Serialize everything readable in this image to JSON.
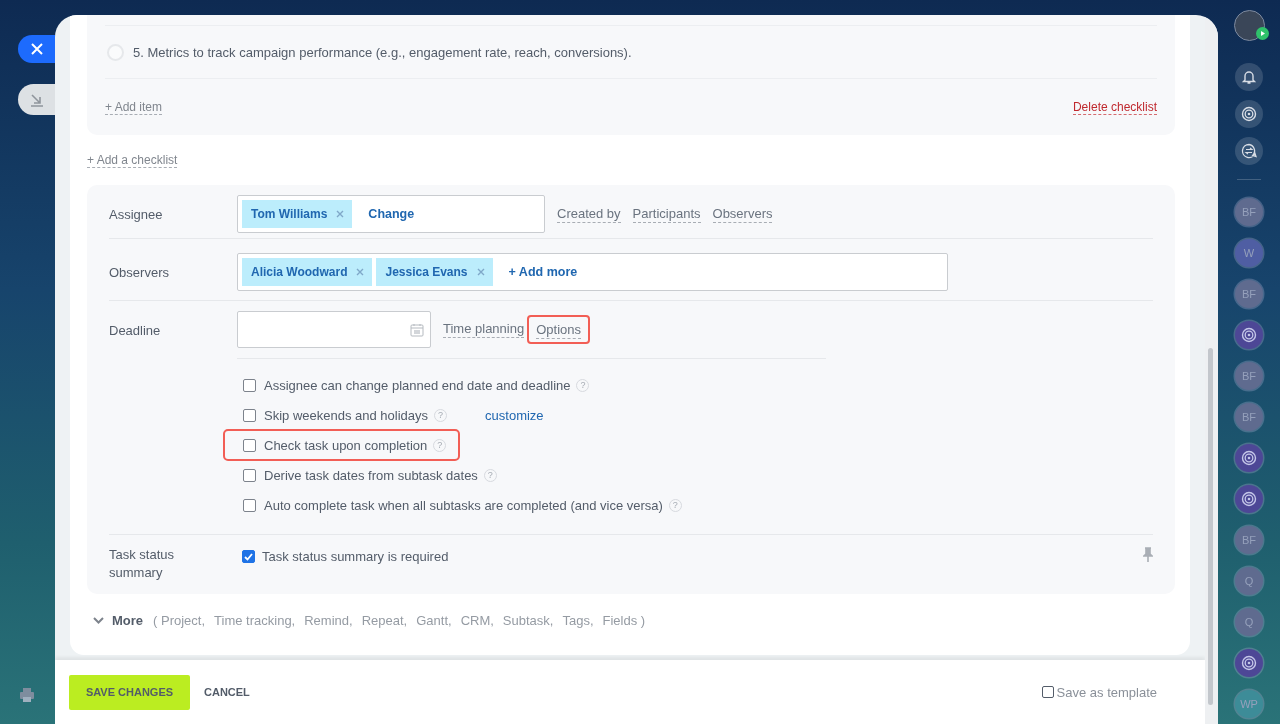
{
  "checklist": {
    "items": [
      {
        "text": "5. Metrics to track campaign performance (e.g., engagement rate, reach, conversions).",
        "checked": false
      }
    ],
    "add_item": "+ Add item",
    "delete": "Delete checklist"
  },
  "add_checklist": "+ Add a checklist",
  "assignee": {
    "label": "Assignee",
    "chips": [
      "Tom Williams"
    ],
    "action": "Change",
    "links": [
      "Created by",
      "Participants",
      "Observers"
    ]
  },
  "observers": {
    "label": "Observers",
    "chips": [
      "Alicia Woodward",
      "Jessica Evans"
    ],
    "action": "+ Add more"
  },
  "deadline": {
    "label": "Deadline",
    "links": [
      {
        "text": "Time planning",
        "highlighted": false
      },
      {
        "text": "Options",
        "highlighted": true
      }
    ]
  },
  "options": [
    {
      "label": "Assignee can change planned end date and deadline",
      "checked": false,
      "help": "?",
      "highlighted": false
    },
    {
      "label": "Skip weekends and holidays",
      "checked": false,
      "help": "?",
      "link": "customize",
      "highlighted": false
    },
    {
      "label": "Check task upon completion",
      "checked": false,
      "help": "?",
      "highlighted": true
    },
    {
      "label": "Derive task dates from subtask dates",
      "checked": false,
      "help": "?",
      "highlighted": false
    },
    {
      "label": "Auto complete task when all subtasks are completed (and vice versa)",
      "checked": false,
      "help": "?",
      "highlighted": false
    }
  ],
  "status_summary": {
    "label": "Task status summary",
    "option": {
      "label": "Task status summary is required",
      "checked": true
    }
  },
  "more": {
    "label": "More",
    "expanded": false,
    "items": [
      "( Project,",
      "Time tracking,",
      "Remind,",
      "Repeat,",
      "Gantt,",
      "CRM,",
      "Subtask,",
      "Tags,",
      "Fields )"
    ]
  },
  "footer": {
    "save": "SAVE CHANGES",
    "cancel": "CANCEL",
    "template": {
      "label": "Save as template",
      "checked": false
    }
  },
  "sidebar": {
    "chats": [
      {
        "kind": "initials",
        "text": "BF",
        "color": "#5f6b8f"
      },
      {
        "kind": "initials",
        "text": "W",
        "color": "#4f5ea3"
      },
      {
        "kind": "initials",
        "text": "BF",
        "color": "#5f6b8f"
      },
      {
        "kind": "icon",
        "color": "#4d4796"
      },
      {
        "kind": "initials",
        "text": "BF",
        "color": "#5f6b8f"
      },
      {
        "kind": "initials",
        "text": "BF",
        "color": "#5f6b8f"
      },
      {
        "kind": "icon",
        "color": "#4d4796"
      },
      {
        "kind": "icon",
        "color": "#4d4796"
      },
      {
        "kind": "initials",
        "text": "BF",
        "color": "#5f6b8f"
      },
      {
        "kind": "initials",
        "text": "Q",
        "color": "#5f6b8f"
      },
      {
        "kind": "initials",
        "text": "Q",
        "color": "#5f6b8f"
      },
      {
        "kind": "icon",
        "color": "#4d4796"
      },
      {
        "kind": "initials",
        "text": "WP",
        "color": "#3d8c98"
      }
    ]
  }
}
